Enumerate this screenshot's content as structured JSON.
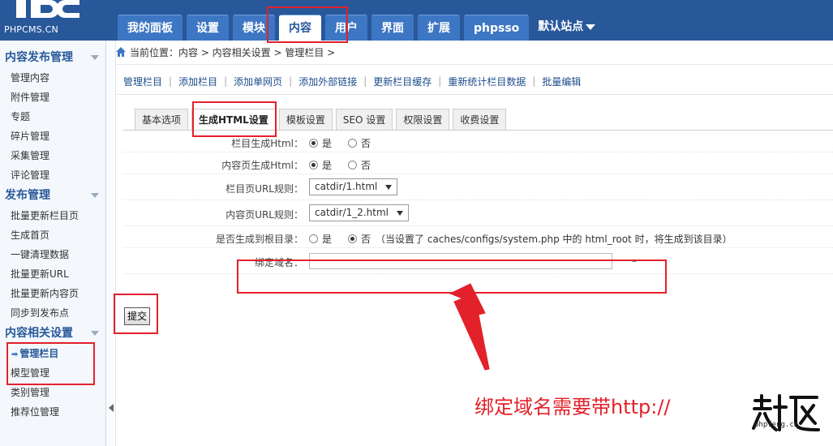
{
  "header": {
    "logo_text": "PHPCMS.CN",
    "nav": [
      "我的面板",
      "设置",
      "模块",
      "内容",
      "用户",
      "界面",
      "扩展",
      "phpsso"
    ],
    "active_nav": "内容",
    "site_label": "默认站点"
  },
  "sidebar": {
    "sections": [
      {
        "title": "内容发布管理",
        "items": [
          "管理内容",
          "附件管理",
          "专题",
          "碎片管理",
          "采集管理",
          "评论管理"
        ]
      },
      {
        "title": "发布管理",
        "items": [
          "批量更新栏目页",
          "生成首页",
          "一键清理数据",
          "批量更新URL",
          "批量更新内容页",
          "同步到发布点"
        ]
      },
      {
        "title": "内容相关设置",
        "items": [
          "管理栏目",
          "模型管理",
          "类别管理",
          "推荐位管理"
        ]
      }
    ],
    "active_item": "管理栏目"
  },
  "breadcrumb": "当前位置：内容 > 内容相关设置 > 管理栏目 >",
  "actions": [
    "管理栏目",
    "添加栏目",
    "添加单网页",
    "添加外部链接",
    "更新栏目缓存",
    "重新统计栏目数据",
    "批量编辑"
  ],
  "tabs": [
    "基本选项",
    "生成HTML设置",
    "模板设置",
    "SEO 设置",
    "权限设置",
    "收费设置"
  ],
  "active_tab": "生成HTML设置",
  "form": {
    "row1": {
      "label": "栏目生成Html：",
      "yes": "是",
      "no": "否",
      "selected": "是"
    },
    "row2": {
      "label": "内容页生成Html：",
      "yes": "是",
      "no": "否",
      "selected": "是"
    },
    "row3": {
      "label": "栏目页URL规则：",
      "value": "catdir/1.html"
    },
    "row4": {
      "label": "内容页URL规则：",
      "value": "catdir/1_2.html"
    },
    "row5": {
      "label": "是否生成到根目录：",
      "yes": "是",
      "no": "否",
      "selected": "否",
      "note": "（当设置了 caches/configs/system.php 中的 html_root 时，将生成到该目录）"
    },
    "row6": {
      "label": "绑定域名：",
      "value": "",
      "dash": "–"
    }
  },
  "submit_label": "提交",
  "annotation": {
    "text": "绑定域名需要带http://",
    "color": "#e3212b"
  },
  "watermark": {
    "url_text": "phpfeng.cn"
  }
}
